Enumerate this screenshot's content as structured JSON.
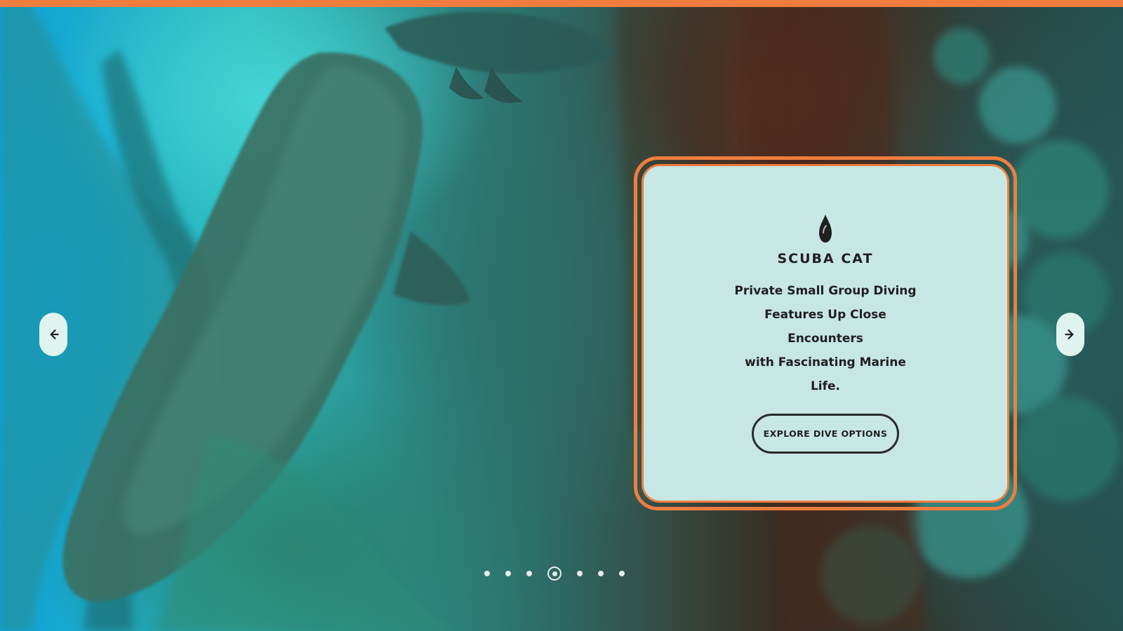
{
  "colors": {
    "accent": "#f07d3e",
    "card_background": "#c7e7e4",
    "text_dark": "#1f1f1f"
  },
  "slider": {
    "prev_icon": "arrow-left-icon",
    "next_icon": "arrow-right-icon",
    "card": {
      "icon": "water-drop-icon",
      "brand": "SCUBA CAT",
      "tagline_lines": [
        "Private Small Group Diving",
        "Features Up Close Encounters",
        "with Fascinating Marine Life."
      ],
      "cta_label": "EXPLORE DIVE OPTIONS"
    },
    "pagination": {
      "count": 7,
      "active_index": 3
    }
  }
}
